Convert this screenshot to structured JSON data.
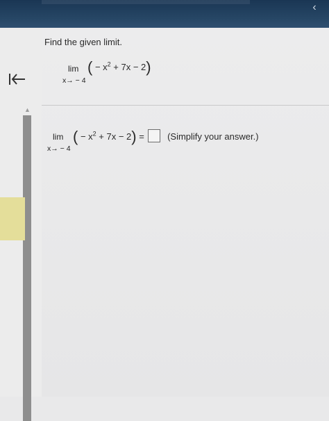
{
  "header": {
    "back_icon": "chevron-left-icon",
    "color": "#1f3d5c"
  },
  "nav": {
    "collapse_icon": "collapse-left-icon"
  },
  "question": {
    "prompt": "Find the given limit.",
    "lim_word": "lim",
    "lim_sub": "x→ − 4",
    "open_paren": "(",
    "expr_a": " − x",
    "exp": "2",
    "expr_b": " + 7x − 2",
    "close_paren": ")"
  },
  "answer": {
    "lim_word": "lim",
    "lim_sub": "x→ − 4",
    "open_paren": "(",
    "expr_a": " − x",
    "exp": "2",
    "expr_b": " + 7x − 2",
    "close_paren": ")",
    "equals": " =",
    "input_value": "",
    "hint": "(Simplify your answer.)"
  },
  "colors": {
    "scroll_thumb": "#e4de9a",
    "scroll_track": "#8e8e8e"
  }
}
